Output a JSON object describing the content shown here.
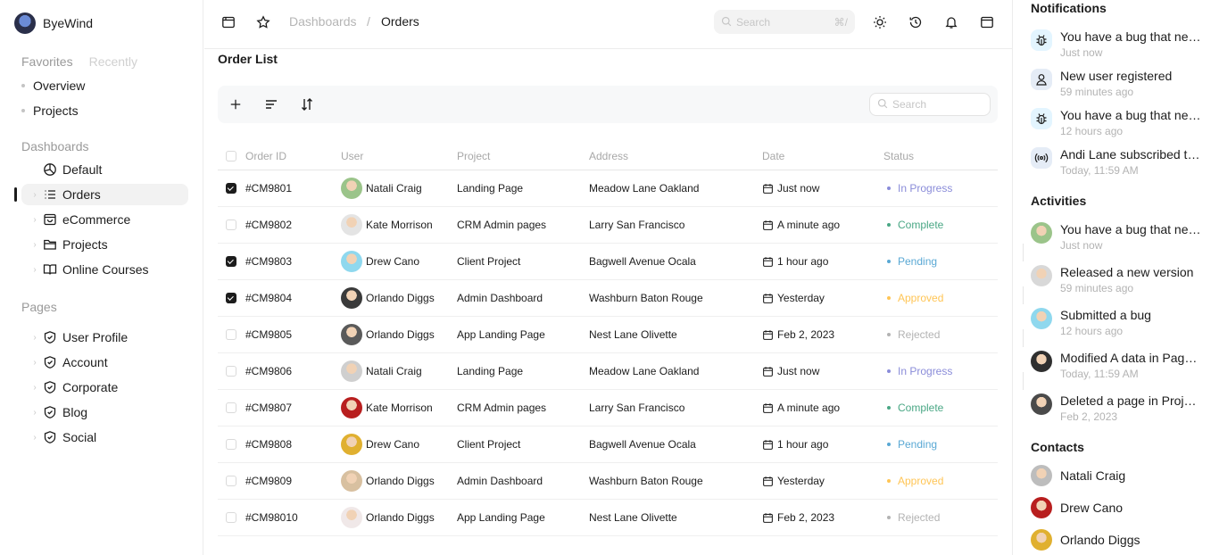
{
  "brand": {
    "name": "ByeWind"
  },
  "favorites": {
    "tab_favorites": "Favorites",
    "tab_recently": "Recently",
    "items": [
      "Overview",
      "Projects"
    ]
  },
  "dashboards": {
    "title": "Dashboards",
    "items": [
      "Default",
      "Orders",
      "eCommerce",
      "Projects",
      "Online Courses"
    ]
  },
  "pages": {
    "title": "Pages",
    "items": [
      "User Profile",
      "Account",
      "Corporate",
      "Blog",
      "Social"
    ]
  },
  "topbar": {
    "breadcrumb_root": "Dashboards",
    "breadcrumb_sep": "/",
    "breadcrumb_current": "Orders",
    "search_placeholder": "Search",
    "search_shortcut": "⌘/"
  },
  "main": {
    "title": "Order List",
    "table_search_placeholder": "Search",
    "columns": [
      "Order ID",
      "User",
      "Project",
      "Address",
      "Date",
      "Status"
    ],
    "rows": [
      {
        "id": "#CM9801",
        "user": "Natali Craig",
        "project": "Landing Page",
        "address": "Meadow Lane Oakland",
        "date": "Just now",
        "status": "In Progress",
        "checked": true
      },
      {
        "id": "#CM9802",
        "user": "Kate Morrison",
        "project": "CRM Admin pages",
        "address": "Larry San Francisco",
        "date": "A minute ago",
        "status": "Complete",
        "checked": false
      },
      {
        "id": "#CM9803",
        "user": "Drew Cano",
        "project": "Client Project",
        "address": "Bagwell Avenue Ocala",
        "date": "1 hour ago",
        "status": "Pending",
        "checked": true
      },
      {
        "id": "#CM9804",
        "user": "Orlando Diggs",
        "project": "Admin Dashboard",
        "address": "Washburn Baton Rouge",
        "date": "Yesterday",
        "status": "Approved",
        "checked": true
      },
      {
        "id": "#CM9805",
        "user": "Orlando Diggs",
        "project": "App Landing Page",
        "address": "Nest Lane Olivette",
        "date": "Feb 2, 2023",
        "status": "Rejected",
        "checked": false
      },
      {
        "id": "#CM9806",
        "user": "Natali Craig",
        "project": "Landing Page",
        "address": "Meadow Lane Oakland",
        "date": "Just now",
        "status": "In Progress",
        "checked": false
      },
      {
        "id": "#CM9807",
        "user": "Kate Morrison",
        "project": "CRM Admin pages",
        "address": "Larry San Francisco",
        "date": "A minute ago",
        "status": "Complete",
        "checked": false
      },
      {
        "id": "#CM9808",
        "user": "Drew Cano",
        "project": "Client Project",
        "address": "Bagwell Avenue Ocala",
        "date": "1 hour ago",
        "status": "Pending",
        "checked": false
      },
      {
        "id": "#CM9809",
        "user": "Orlando Diggs",
        "project": "Admin Dashboard",
        "address": "Washburn Baton Rouge",
        "date": "Yesterday",
        "status": "Approved",
        "checked": false
      },
      {
        "id": "#CM98010",
        "user": "Orlando Diggs",
        "project": "App Landing Page",
        "address": "Nest Lane Olivette",
        "date": "Feb 2, 2023",
        "status": "Rejected",
        "checked": false
      }
    ]
  },
  "status_colors": {
    "In Progress": "#8a8cd9",
    "Complete": "#4aa785",
    "Pending": "#59a8d4",
    "Approved": "#ffc555",
    "Rejected": "#b3b3b3"
  },
  "avatar_colors": [
    "#9bc48a",
    "#e4e4e4",
    "#8fd8ee",
    "#3a3a3a",
    "#5a5a5a",
    "#cfcfcf",
    "#b81e1e",
    "#e0b030",
    "#d8c0a0",
    "#f0e8e8"
  ],
  "notifications": {
    "title": "Notifications",
    "items": [
      {
        "text": "You have a bug that needs to be fixed",
        "time": "Just now",
        "icon": "bug-icon",
        "bg": "#e3f5ff"
      },
      {
        "text": "New user registered",
        "time": "59 minutes ago",
        "icon": "user-icon",
        "bg": "#e5ecf6"
      },
      {
        "text": "You have a bug that needs to be fixed",
        "time": "12 hours ago",
        "icon": "bug-icon",
        "bg": "#e3f5ff"
      },
      {
        "text": "Andi Lane subscribed to you",
        "time": "Today, 11:59 AM",
        "icon": "broadcast-icon",
        "bg": "#e5ecf6"
      }
    ]
  },
  "activities": {
    "title": "Activities",
    "items": [
      {
        "text": "You have a bug that needs to be fixed",
        "time": "Just now",
        "color": "#9bc48a"
      },
      {
        "text": "Released a new version",
        "time": "59 minutes ago",
        "color": "#d8d8d8"
      },
      {
        "text": "Submitted a bug",
        "time": "12 hours ago",
        "color": "#8fd8ee"
      },
      {
        "text": "Modified A data in Page X",
        "time": "Today, 11:59 AM",
        "color": "#2f2f2f"
      },
      {
        "text": "Deleted a page in Project X",
        "time": "Feb 2, 2023",
        "color": "#4a4a4a"
      }
    ]
  },
  "contacts": {
    "title": "Contacts",
    "items": [
      {
        "name": "Natali Craig",
        "color": "#bdbdbd"
      },
      {
        "name": "Drew Cano",
        "color": "#b81e1e"
      },
      {
        "name": "Orlando Diggs",
        "color": "#e0b030"
      }
    ]
  }
}
